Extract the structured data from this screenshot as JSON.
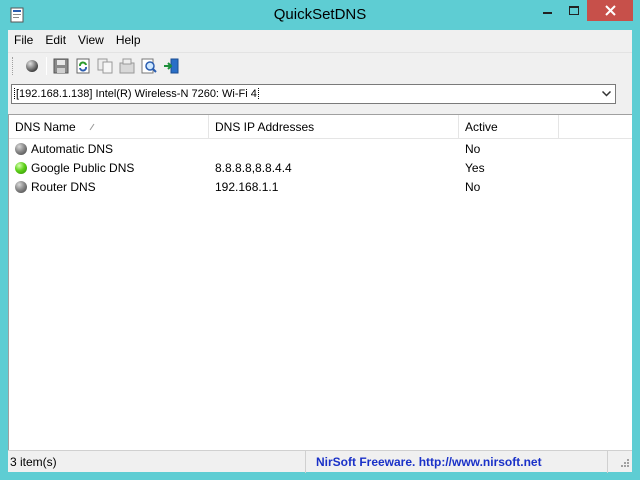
{
  "window": {
    "title": "QuickSetDNS",
    "app_icon": "dns-app-icon",
    "controls": [
      "minimize-icon",
      "maximize-icon",
      "close-icon"
    ]
  },
  "menu": {
    "items": [
      {
        "label": "File"
      },
      {
        "label": "Edit"
      },
      {
        "label": "View"
      },
      {
        "label": "Help"
      }
    ]
  },
  "toolbar": {
    "buttons": [
      {
        "icon": "set-dns-icon"
      },
      {
        "icon": "save-icon"
      },
      {
        "icon": "refresh-icon"
      },
      {
        "icon": "copy-icon"
      },
      {
        "icon": "properties-icon"
      },
      {
        "icon": "find-icon"
      },
      {
        "icon": "exit-icon"
      }
    ]
  },
  "adapter": {
    "selected": "[192.168.1.138]  Intel(R) Wireless-N 7260: Wi-Fi 4"
  },
  "list": {
    "columns": [
      "DNS Name",
      "DNS IP Addresses",
      "Active"
    ],
    "sort_column": "DNS Name",
    "rows": [
      {
        "name": "Automatic DNS",
        "ips": "",
        "active": "No",
        "status_color": "#8a8a8a"
      },
      {
        "name": "Google Public DNS",
        "ips": "8.8.8.8,8.8.4.4",
        "active": "Yes",
        "status_color": "#5fd11a"
      },
      {
        "name": "Router DNS",
        "ips": "192.168.1.1",
        "active": "No",
        "status_color": "#8a8a8a"
      }
    ]
  },
  "status": {
    "count": "3 item(s)",
    "credit": "NirSoft Freeware.  http://www.nirsoft.net"
  },
  "colors": {
    "frame": "#5ecdd3",
    "close_button": "#c7504a",
    "credit_text": "#1a31c8"
  }
}
